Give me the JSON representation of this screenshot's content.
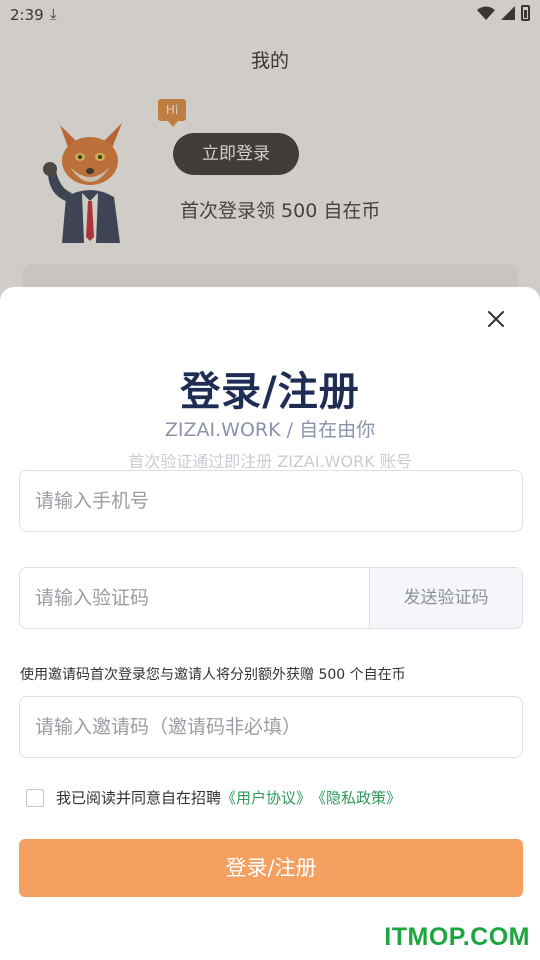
{
  "status_bar": {
    "time": "2:39"
  },
  "background_page": {
    "title": "我的",
    "hi_label": "Hi",
    "login_button": "立即登录",
    "promo": "首次登录领 500 自在币"
  },
  "sheet": {
    "title": "登录/注册",
    "subtitle": "ZIZAI.WORK / 自在由你",
    "hint": "首次验证通过即注册 ZIZAI.WORK 账号",
    "phone_placeholder": "请输入手机号",
    "code_placeholder": "请输入验证码",
    "send_code_label": "发送验证码",
    "invite_hint": "使用邀请码首次登录您与邀请人将分别额外获赠 500 个自在币",
    "invite_placeholder": "请输入邀请码（邀请码非必填）",
    "agree_text": "我已阅读并同意自在招聘",
    "user_agreement": "《用户协议》",
    "privacy_policy": "《隐私政策》",
    "submit_label": "登录/注册"
  },
  "watermark": "ITMOP.COM",
  "colors": {
    "title": "#1f2d55",
    "accent_button": "#f3a060",
    "link": "#2b9a5a",
    "watermark": "#1da63f"
  }
}
